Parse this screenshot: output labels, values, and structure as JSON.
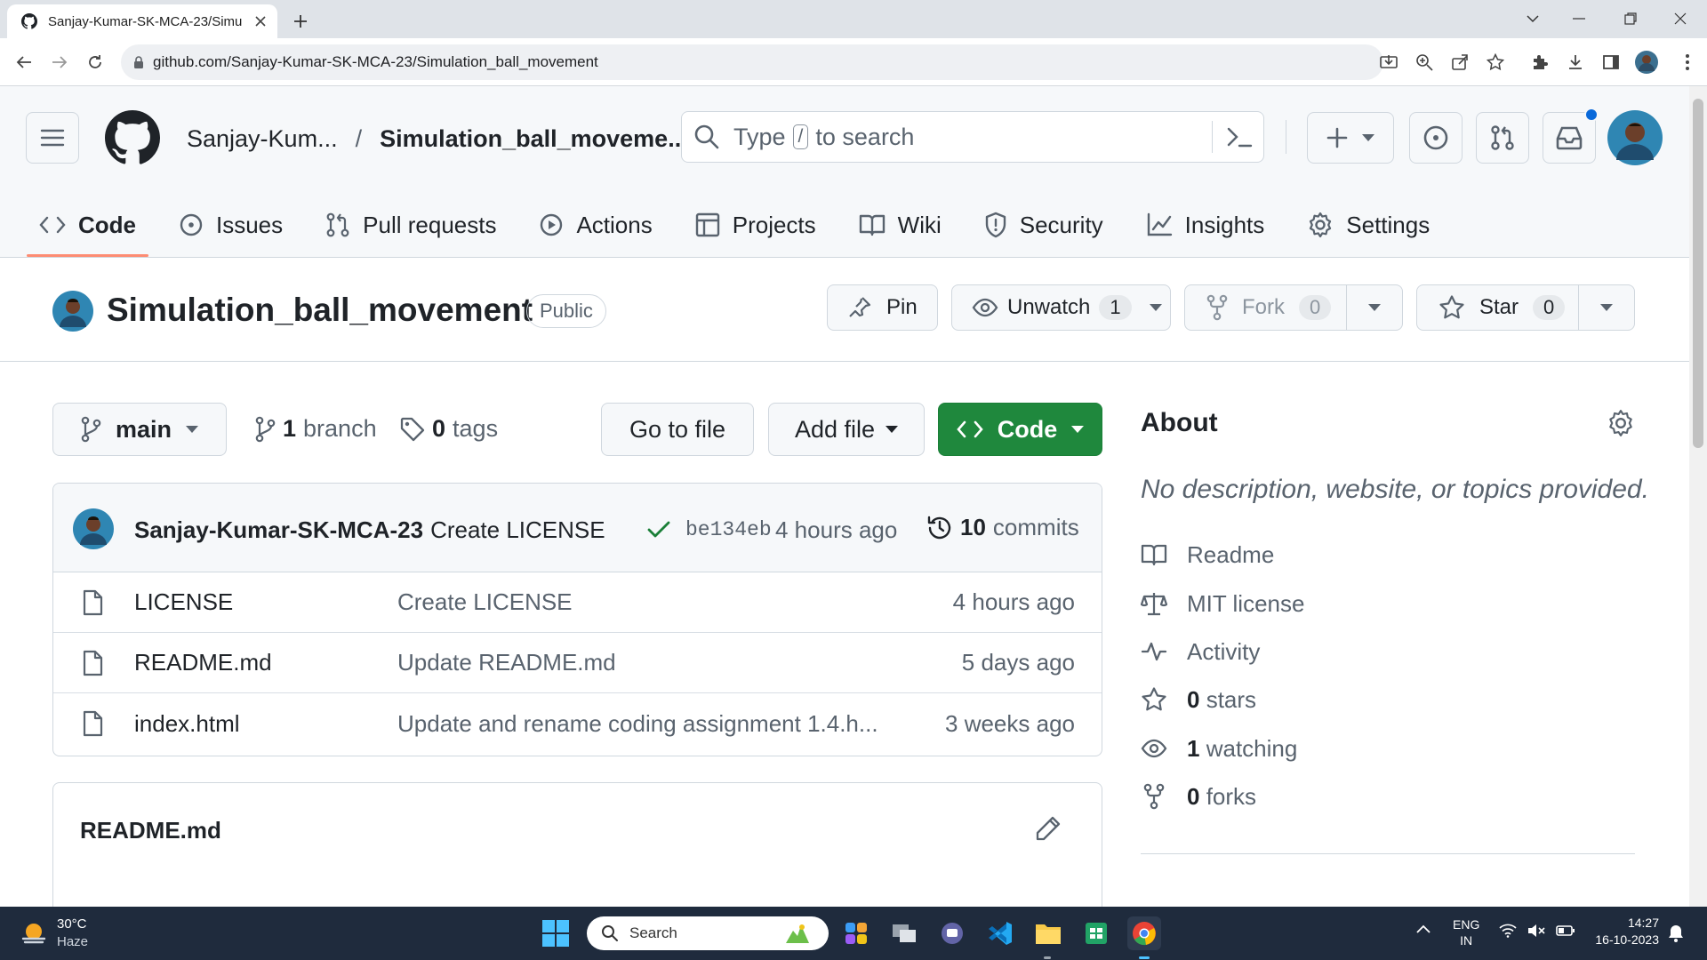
{
  "browser": {
    "tab_title": "Sanjay-Kumar-SK-MCA-23/Simu",
    "url": "github.com/Sanjay-Kumar-SK-MCA-23/Simulation_ball_movement",
    "new_tab_icon": "plus-icon"
  },
  "header": {
    "owner": "Sanjay-Kum...",
    "separator": "/",
    "repo": "Simulation_ball_moveme...",
    "search_pre": "Type",
    "search_key": "/",
    "search_post": "to search",
    "notification_color": "#0969da"
  },
  "nav": [
    {
      "label": "Code",
      "icon": "code-icon"
    },
    {
      "label": "Issues",
      "icon": "issue-icon"
    },
    {
      "label": "Pull requests",
      "icon": "pull-request-icon"
    },
    {
      "label": "Actions",
      "icon": "play-icon"
    },
    {
      "label": "Projects",
      "icon": "table-icon"
    },
    {
      "label": "Wiki",
      "icon": "book-icon"
    },
    {
      "label": "Security",
      "icon": "shield-icon"
    },
    {
      "label": "Insights",
      "icon": "graph-icon"
    },
    {
      "label": "Settings",
      "icon": "gear-icon"
    }
  ],
  "repo": {
    "title": "Simulation_ball_movement",
    "visibility": "Public",
    "pin": "Pin",
    "unwatch": "Unwatch",
    "watch_count": "1",
    "fork": "Fork",
    "fork_count": "0",
    "star": "Star",
    "star_count": "0"
  },
  "toolbar": {
    "branch": "main",
    "branches_count": "1",
    "branches_label": "branch",
    "tags_count": "0",
    "tags_label": "tags",
    "go_to_file": "Go to file",
    "add_file": "Add file",
    "code": "Code"
  },
  "commit": {
    "author": "Sanjay-Kumar-SK-MCA-23",
    "message": "Create LICENSE",
    "sha": "be134eb",
    "time": "4 hours ago",
    "commits_count": "10",
    "commits_label": "commits",
    "status_color": "#1a7f37"
  },
  "files": [
    {
      "name": "LICENSE",
      "message": "Create LICENSE",
      "age": "4 hours ago"
    },
    {
      "name": "README.md",
      "message": "Update README.md",
      "age": "5 days ago"
    },
    {
      "name": "index.html",
      "message": "Update and rename coding assignment 1.4.h...",
      "age": "3 weeks ago"
    }
  ],
  "readme": {
    "title": "README.md"
  },
  "about": {
    "title": "About",
    "description": "No description, website, or topics provided.",
    "readme": "Readme",
    "license": "MIT license",
    "activity": "Activity",
    "stars_count": "0",
    "stars_label": "stars",
    "watching_count": "1",
    "watching_label": "watching",
    "forks_count": "0",
    "forks_label": "forks"
  },
  "taskbar": {
    "temperature": "30°C",
    "weather": "Haze",
    "search": "Search",
    "lang": "ENG",
    "region": "IN",
    "time": "14:27",
    "date": "16-10-2023"
  }
}
